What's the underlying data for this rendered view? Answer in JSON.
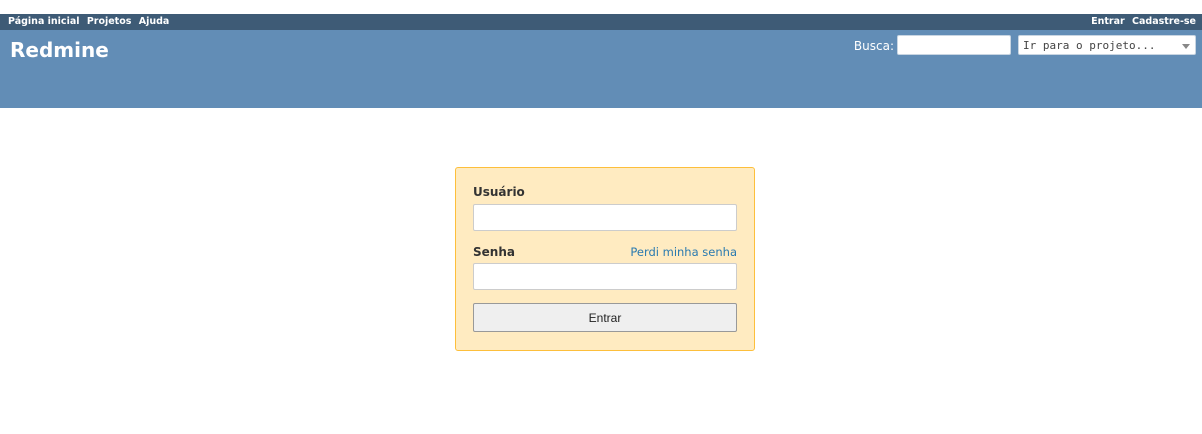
{
  "top_menu": {
    "left_items": [
      "Página inicial",
      "Projetos",
      "Ajuda"
    ],
    "right_items": [
      "Entrar",
      "Cadastre-se"
    ]
  },
  "header": {
    "title": "Redmine",
    "search_label": "Busca:",
    "search_value": "",
    "jump_placeholder": "Ir para o projeto..."
  },
  "login": {
    "username_label": "Usuário",
    "username_value": "",
    "password_label": "Senha",
    "password_value": "",
    "lost_password": "Perdi minha senha",
    "submit_label": "Entrar"
  },
  "colors": {
    "top_menu_bg": "#3e5b76",
    "header_bg": "#628db6",
    "login_bg": "#ffebc1",
    "login_border": "#fdbf3b"
  }
}
